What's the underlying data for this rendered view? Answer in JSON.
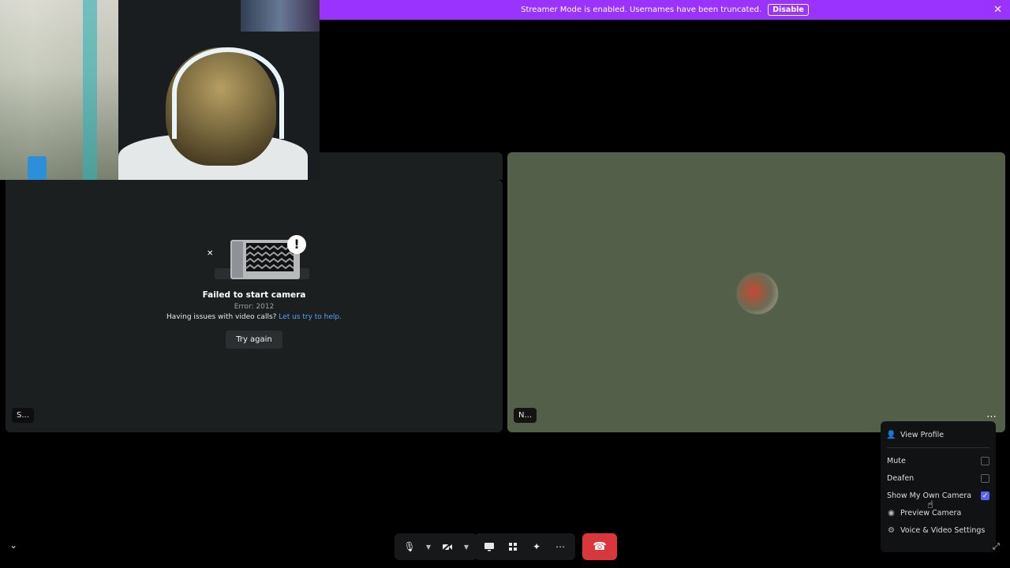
{
  "banner": {
    "message": "Streamer Mode is enabled. Usernames have been truncated.",
    "disable_label": "Disable",
    "close_icon": "close-icon",
    "color": "#9b33ff"
  },
  "tiles": {
    "left": {
      "error_title": "Failed to start camera",
      "error_code": "Error: 2012",
      "help_text": "Having issues with video calls?",
      "help_link": "Let us try to help.",
      "retry_label": "Try again",
      "name_tag": "S..."
    },
    "right": {
      "name_tag": "N...",
      "more_label": "⋯",
      "bg_color": "#545f4a"
    }
  },
  "context_menu": {
    "items": [
      {
        "label": "View Profile",
        "icon": "person-icon"
      },
      {
        "label": "Mute",
        "checked": false
      },
      {
        "label": "Deafen",
        "checked": false
      },
      {
        "label": "Show My Own Camera",
        "checked": true
      },
      {
        "label": "Preview Camera",
        "icon": "eye-icon"
      },
      {
        "label": "Voice & Video Settings",
        "icon": "gear-icon"
      }
    ],
    "accent": "#5865f2"
  },
  "controls": {
    "icons": [
      "microphone-icon",
      "camera-off-icon",
      "screen-share-icon",
      "activities-icon",
      "soundboard-icon",
      "more-icon",
      "hang-up-icon"
    ],
    "hangup_color": "#da373c"
  }
}
